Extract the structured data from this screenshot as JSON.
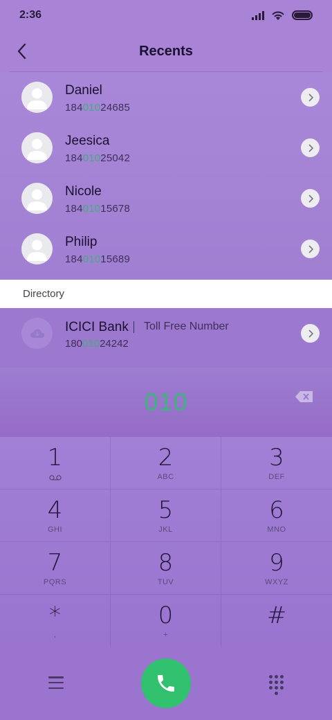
{
  "status_bar": {
    "time": "2:36"
  },
  "header": {
    "title": "Recents"
  },
  "recents": [
    {
      "name": "Daniel",
      "number_prefix": "184",
      "number_match": "010",
      "number_suffix": "24685"
    },
    {
      "name": "Jeesica",
      "number_prefix": "184",
      "number_match": "010",
      "number_suffix": "25042"
    },
    {
      "name": "Nicole",
      "number_prefix": "184",
      "number_match": "010",
      "number_suffix": "15678"
    },
    {
      "name": "Philip",
      "number_prefix": "184",
      "number_match": "010",
      "number_suffix": "15689"
    }
  ],
  "directory": {
    "title": "Directory",
    "entry": {
      "name": "ICICI Bank",
      "tag": "Toll Free Number",
      "number_prefix": "180",
      "number_match": "010",
      "number_suffix": "24242"
    }
  },
  "dialer": {
    "dialed": "010"
  },
  "keypad": [
    {
      "digit": "1",
      "letters": "voicemail-icon"
    },
    {
      "digit": "2",
      "letters": "ABC"
    },
    {
      "digit": "3",
      "letters": "DEF"
    },
    {
      "digit": "4",
      "letters": "GHI"
    },
    {
      "digit": "5",
      "letters": "JKL"
    },
    {
      "digit": "6",
      "letters": "MNO"
    },
    {
      "digit": "7",
      "letters": "PQRS"
    },
    {
      "digit": "8",
      "letters": "TUV"
    },
    {
      "digit": "9",
      "letters": "WXYZ"
    },
    {
      "digit": "*",
      "letters": ","
    },
    {
      "digit": "0",
      "letters": "+"
    },
    {
      "digit": "#",
      "letters": ""
    }
  ],
  "colors": {
    "accent": "#3fb27e",
    "call_button": "#31c06e",
    "background": "#a883d6"
  },
  "icons": [
    "back-arrow-icon",
    "chevron-right-icon",
    "contact-avatar-icon",
    "cloud-icon",
    "backspace-icon",
    "menu-icon",
    "phone-icon",
    "dialpad-icon",
    "wifi-icon",
    "signal-icon",
    "battery-icon"
  ]
}
